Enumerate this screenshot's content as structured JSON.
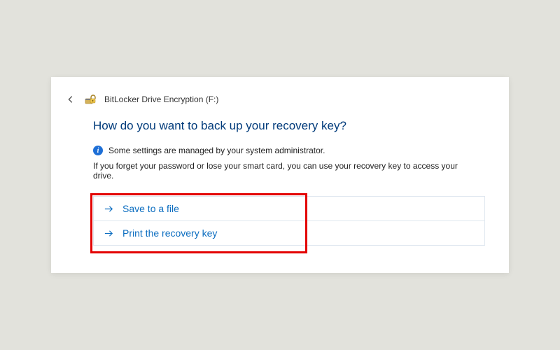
{
  "titlebar": {
    "title": "BitLocker Drive Encryption (F:)"
  },
  "content": {
    "heading": "How do you want to back up your recovery key?",
    "admin_notice": "Some settings are managed by your system administrator.",
    "forget_text": "If you forget your password or lose your smart card, you can use your recovery key to access your drive."
  },
  "options": {
    "save_file": "Save to a file",
    "print": "Print the recovery key"
  }
}
